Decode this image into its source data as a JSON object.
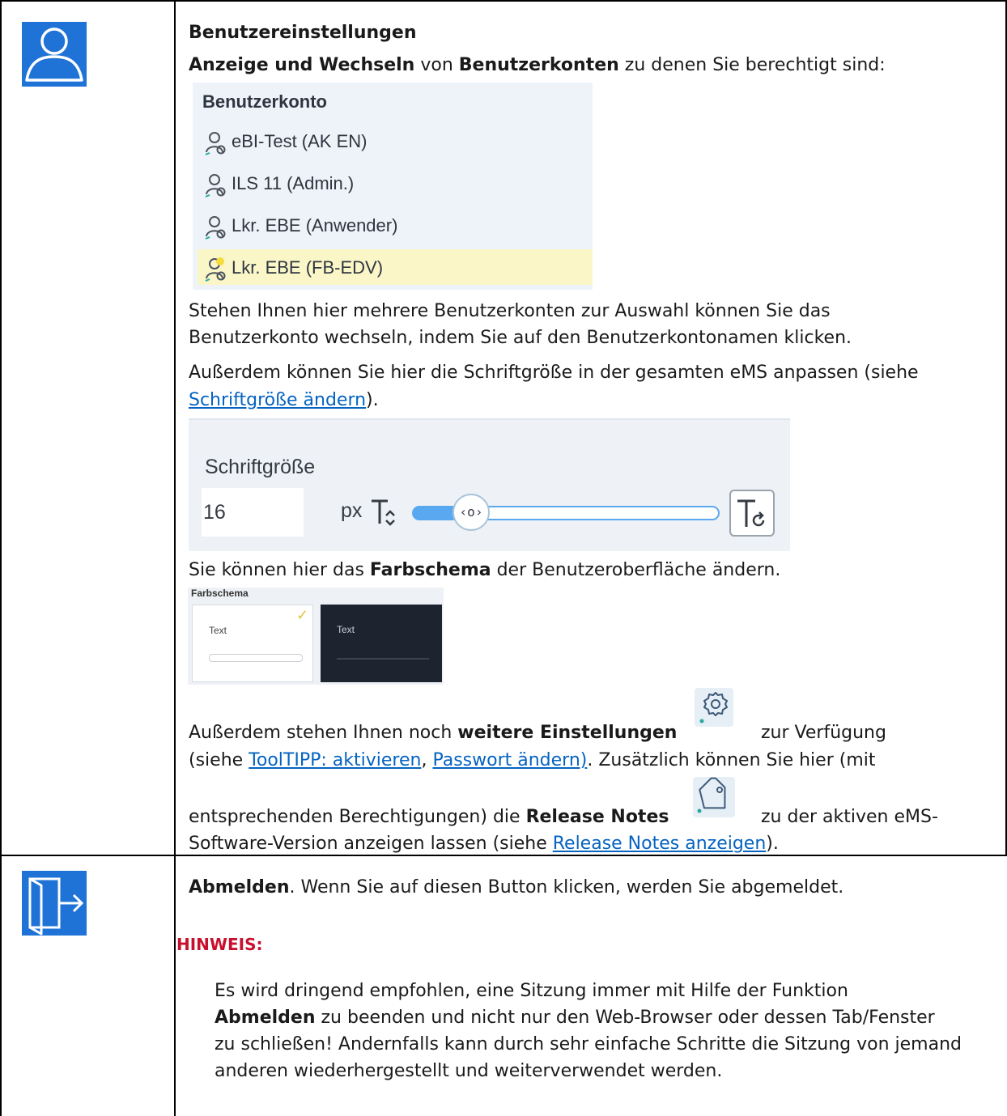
{
  "section_account": {
    "title": "Benutzereinstellungen",
    "intro_bold_1": "Anzeige und Wechseln",
    "intro_text_1": " von ",
    "intro_bold_2": "Benutzerkonten",
    "intro_text_2": " zu denen Sie berechtigt sind:",
    "account_panel": {
      "header": "Benutzerkonto",
      "accounts": [
        "eBI-Test (AK EN)",
        "ILS 11 (Admin.)",
        "Lkr. EBE (Anwender)",
        "Lkr. EBE (FB-EDV)"
      ],
      "active_index": 3
    },
    "switch_line_1": "Stehen Ihnen hier mehrere Benutzerkonten zur Auswahl können Sie das",
    "switch_line_2": "Benutzerkonto wechseln, indem Sie auf den Benutzerkontonamen klicken.",
    "font_line_1": "Außerdem können Sie hier die Schriftgröße in der gesamten eMS anpassen (siehe",
    "font_link": "Schriftgröße ändern",
    "font_line_2_end": ").",
    "font_panel": {
      "label": "Schriftgröße",
      "value": "16",
      "unit": "px",
      "slider_level": 0.18
    },
    "scheme_line_start": "Sie können hier das ",
    "scheme_bold": "Farbschema",
    "scheme_line_end": " der Benutzeroberfläche ändern.",
    "scheme_panel": {
      "label": "Farbschema",
      "light_text": "Text",
      "dark_text": "Text",
      "selected": "light"
    },
    "settings_line_start": "Außerdem stehen Ihnen noch ",
    "settings_bold": "weitere Einstellungen",
    "settings_line_end": "zur Verfügung",
    "settings_line2_start": "(siehe ",
    "link_tooltipp": "ToolTIPP: aktivieren",
    "settings_comma": ", ",
    "link_passwort": "Passwort ändern)",
    "settings_line2_end": ". Zusätzlich können Sie hier (mit",
    "release_line_start": "entsprechenden Berechtigungen) die ",
    "release_bold": "Release Notes",
    "release_line_end": "zu der aktiven eMS-",
    "release_line2_start": "Software-Version anzeigen lassen (siehe ",
    "link_release": "Release Notes anzeigen",
    "release_line2_end": ")."
  },
  "section_logout": {
    "bold": "Abmelden",
    "text": ". Wenn Sie auf diesen Button klicken, werden Sie abgemeldet.",
    "note_label": "HINWEIS:",
    "note_line_1": "Es wird dringend empfohlen, eine Sitzung immer mit Hilfe der Funktion",
    "note_bold": "Abmelden",
    "note_line_2_end": " zu beenden und nicht nur den Web-Browser oder dessen Tab/Fenster",
    "note_line_3": "zu schließen! Andernfalls kann durch sehr einfache Schritte die Sitzung von jemand",
    "note_line_4": "anderen wiederhergestellt und weiterverwendet werden."
  },
  "colors": {
    "icon_blue": "#1f73d6",
    "link": "#0563c1",
    "note_red": "#c8102e",
    "active_account": "#fbf6c8",
    "slider_blue": "#5aa9f0"
  }
}
